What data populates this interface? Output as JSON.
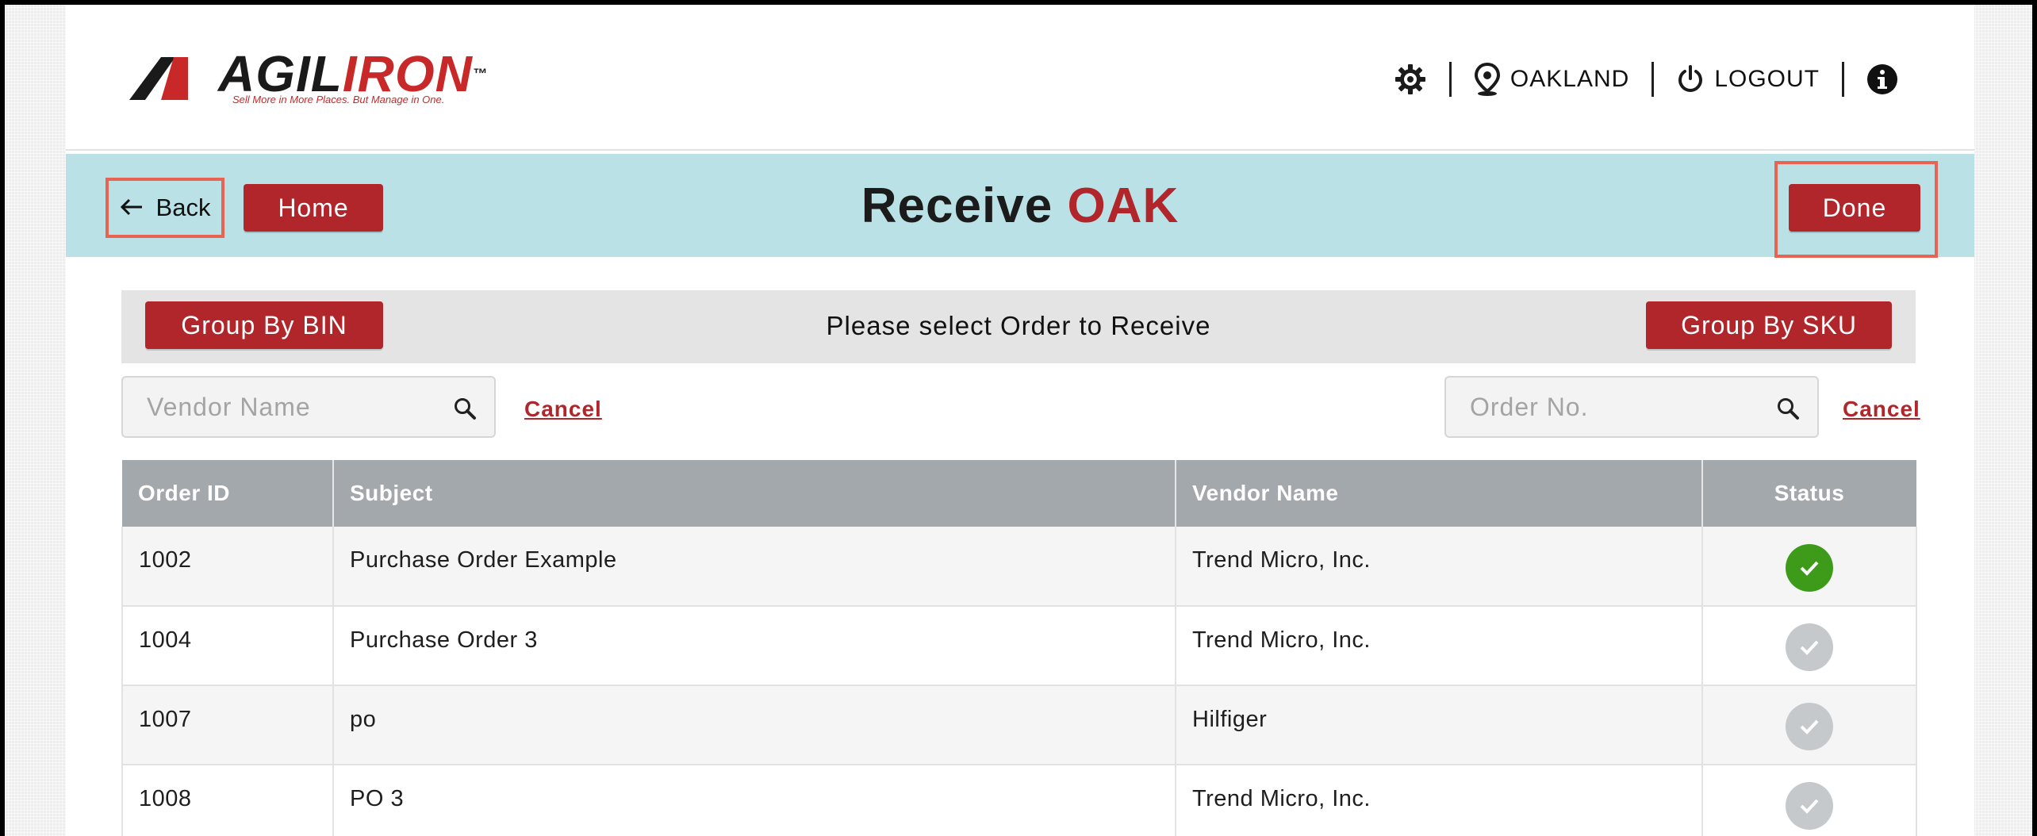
{
  "header": {
    "logo": {
      "brand_part1": "AGIL",
      "brand_part2": "IRON",
      "tagline": "Sell More in More Places. But Manage in One.",
      "trademark": "™"
    },
    "location_label": "OAKLAND",
    "logout_label": "LOGOUT",
    "icons": {
      "settings": "gear-icon",
      "location": "map-pin-icon",
      "logout": "power-icon",
      "info": "info-icon"
    }
  },
  "titlebar": {
    "back_label": "Back",
    "home_label": "Home",
    "title": "Receive",
    "title_location": "OAK",
    "done_label": "Done"
  },
  "groupbar": {
    "bin_label": "Group By BIN",
    "prompt": "Please select Order to Receive",
    "sku_label": "Group By SKU"
  },
  "search": {
    "vendor_placeholder": "Vendor Name",
    "vendor_cancel": "Cancel",
    "order_placeholder": "Order No.",
    "order_cancel": "Cancel"
  },
  "table": {
    "columns": [
      "Order ID",
      "Subject",
      "Vendor Name",
      "Status"
    ],
    "rows": [
      {
        "order_id": "1002",
        "subject": "Purchase Order Example",
        "vendor": "Trend Micro, Inc.",
        "status": "complete"
      },
      {
        "order_id": "1004",
        "subject": "Purchase Order 3",
        "vendor": "Trend Micro, Inc.",
        "status": "pending"
      },
      {
        "order_id": "1007",
        "subject": "po",
        "vendor": "Hilfiger",
        "status": "pending"
      },
      {
        "order_id": "1008",
        "subject": "PO 3",
        "vendor": "Trend Micro, Inc.",
        "status": "pending"
      }
    ]
  },
  "colors": {
    "brand_red": "#b0262b",
    "titlebar_bg": "#bae2e6",
    "highlight_outline": "#e86352",
    "status_complete": "#3e9b1a",
    "status_pending": "#c5c9cb",
    "table_header_bg": "#a2a8ab"
  }
}
